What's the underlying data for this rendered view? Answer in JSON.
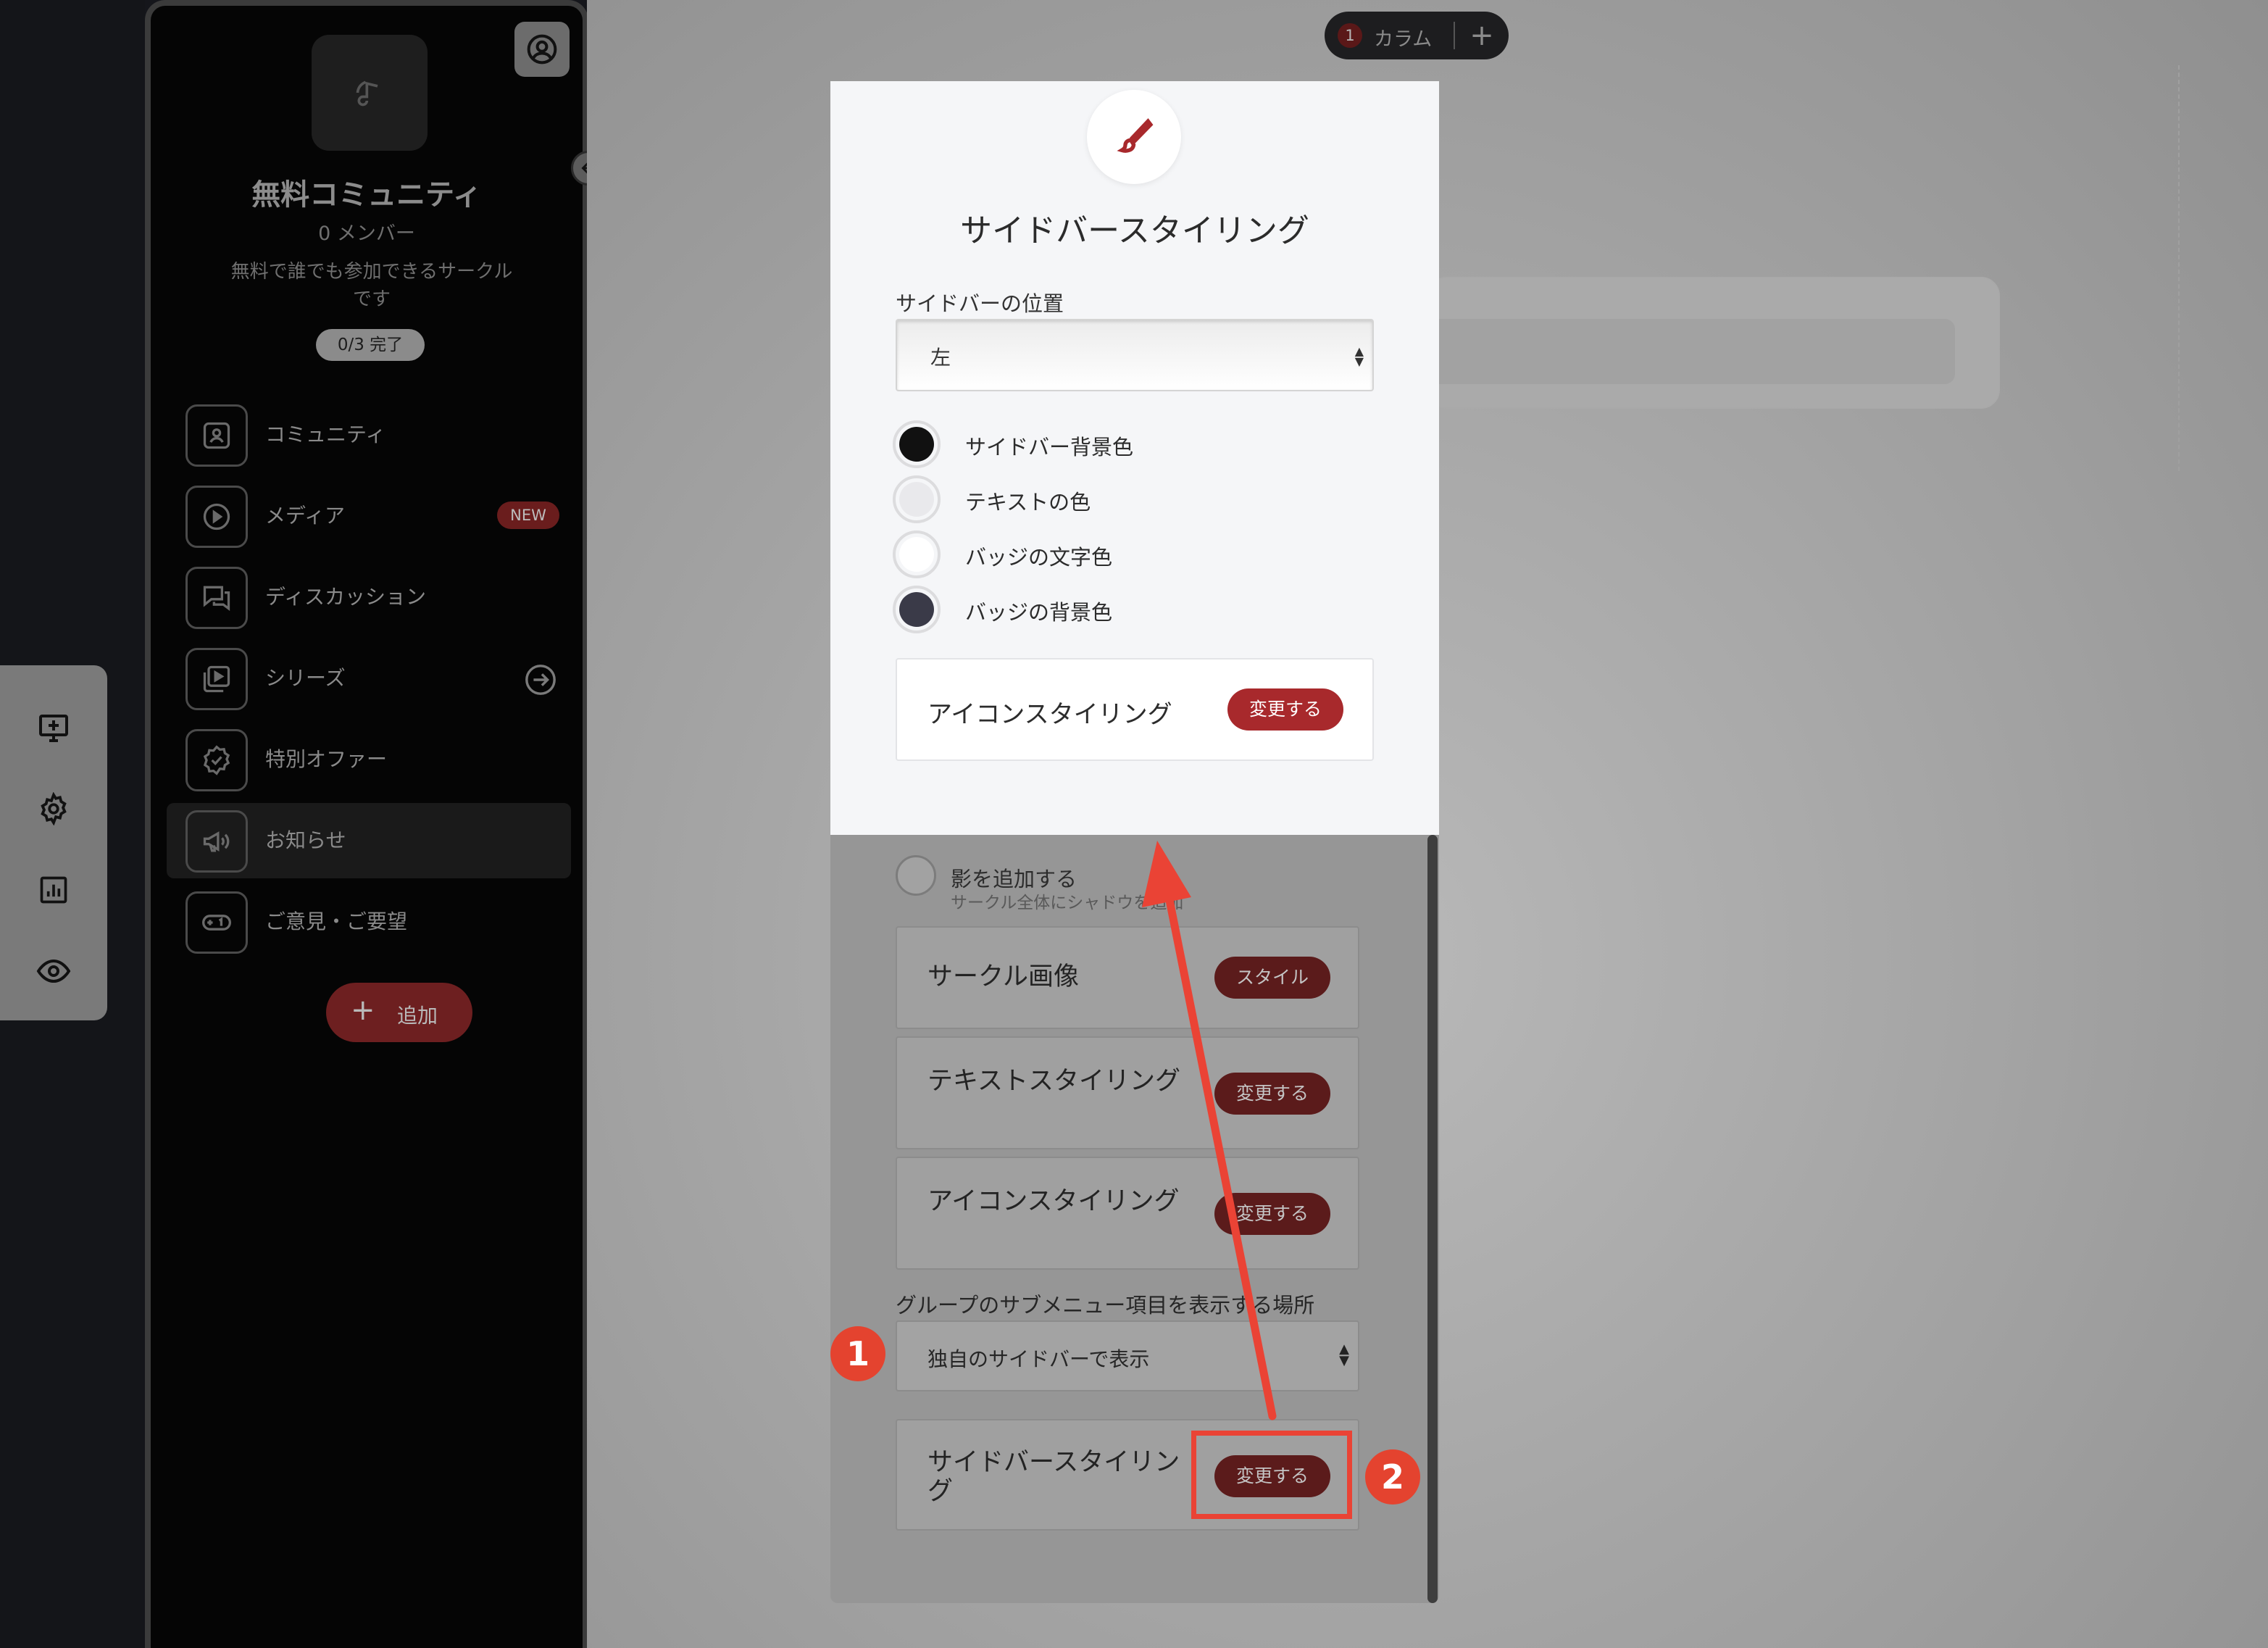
{
  "sidebar": {
    "community_name": "無料コミュニティ",
    "member_count": "0 メンバー",
    "description": "無料で誰でも参加できるサークルです",
    "progress": "0/3 完了",
    "items": [
      {
        "label": "コミュニティ",
        "icon": "community-icon"
      },
      {
        "label": "メディア",
        "icon": "play-icon",
        "badge": "NEW"
      },
      {
        "label": "ディスカッション",
        "icon": "chat-icon"
      },
      {
        "label": "シリーズ",
        "icon": "series-icon"
      },
      {
        "label": "特別オファー",
        "icon": "verified-badge-icon"
      },
      {
        "label": "お知らせ",
        "icon": "megaphone-icon"
      },
      {
        "label": "ご意見・ご要望",
        "icon": "feedback-icon"
      }
    ],
    "add_label": "追加"
  },
  "columns": {
    "count": "1",
    "label": "カラム",
    "add": "+"
  },
  "settings": {
    "shadow_title": "影を追加する",
    "shadow_desc": "サークル全体にシャドウを追加",
    "rows": [
      {
        "label": "サークル画像",
        "button": "スタイル"
      },
      {
        "label": "テキストスタイリング",
        "button": "変更する"
      },
      {
        "label": "アイコンスタイリング",
        "button": "変更する"
      }
    ],
    "submenu_label": "グループのサブメニュー項目を表示する場所",
    "submenu_value": "独自のサイドバーで表示",
    "sidebar_styling_label": "サイドバースタイリング",
    "sidebar_styling_button": "変更する"
  },
  "modal": {
    "title": "サイドバースタイリング",
    "position_label": "サイドバーの位置",
    "position_value": "左",
    "colors": [
      {
        "label": "サイドバー背景色",
        "color": "#111111"
      },
      {
        "label": "テキストの色",
        "color": "#e9e9ec"
      },
      {
        "label": "バッジの文字色",
        "color": "#ffffff"
      },
      {
        "label": "バッジの背景色",
        "color": "#3a3a48"
      }
    ],
    "icon_styling_label": "アイコンスタイリング",
    "icon_styling_button": "変更する"
  },
  "annotations": {
    "step1": "1",
    "step2": "2",
    "highlight_color": "#ea4335"
  }
}
